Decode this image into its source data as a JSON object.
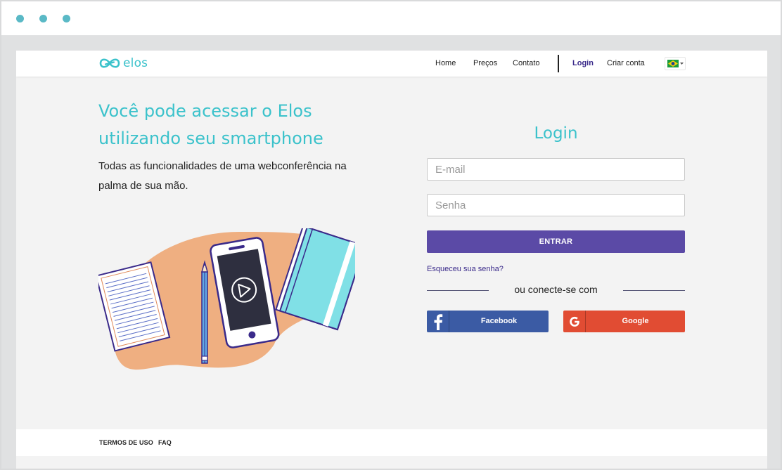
{
  "nav": {
    "logo_text": "elos",
    "home": "Home",
    "precos": "Preços",
    "contato": "Contato",
    "login": "Login",
    "criar_conta": "Criar conta",
    "language_flag": "brazil-flag"
  },
  "hero": {
    "title_line1": "Você pode acessar o Elos",
    "title_line2": "utilizando seu smartphone",
    "subtitle_line1": "Todas as funcionalidades de uma webconferência na",
    "subtitle_line2": "palma de sua mão."
  },
  "login": {
    "title": "Login",
    "email_placeholder": "E-mail",
    "password_placeholder": "Senha",
    "submit_label": "ENTRAR",
    "forgot_label": "Esqueceu sua senha?",
    "divider_label": "ou conecte-se com",
    "facebook_label": "Facebook",
    "google_label": "Google"
  },
  "footer": {
    "terms": "TERMOS DE USO",
    "faq": "FAQ"
  },
  "colors": {
    "brand": "#3bc2cb",
    "primary_button": "#5b4aa6",
    "facebook": "#3b5ba4",
    "google": "#e14c33",
    "link": "#3a2a8a"
  }
}
